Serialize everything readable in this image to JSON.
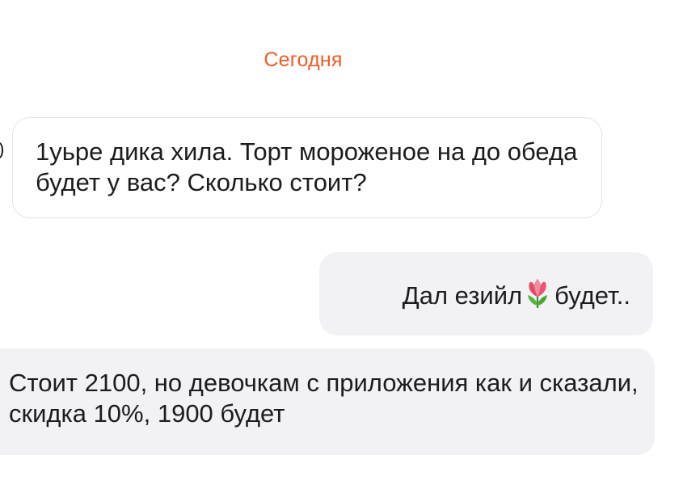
{
  "chat": {
    "date_label": "Сегодня",
    "messages": [
      {
        "direction": "incoming",
        "text": "1уьре дика хила. Торт мороженое на до обеда будет у вас? Сколько стоит?"
      },
      {
        "direction": "outgoing",
        "text_before_emoji": "Дал езийл",
        "emoji": "tulip-icon",
        "text_after_emoji": "будет.."
      },
      {
        "direction": "incoming",
        "text": "Стоит 2100, но девочкам с приложения как и сказали, скидка 10%, 1900 будет"
      }
    ]
  },
  "colors": {
    "date_label": "#ef5b25",
    "bubble_light": "#f2f2f5",
    "bubble_border": "#e3e3e6",
    "text": "#1c1c1e"
  }
}
